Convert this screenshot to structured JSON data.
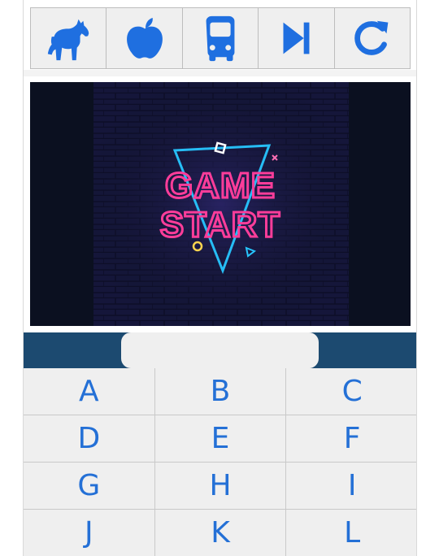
{
  "toolbar": {
    "buttons": [
      {
        "icon": "horse-icon",
        "action": "category"
      },
      {
        "icon": "apple-icon",
        "action": "category"
      },
      {
        "icon": "bus-icon",
        "action": "category"
      },
      {
        "icon": "skip-icon",
        "action": "skip"
      },
      {
        "icon": "redo-icon",
        "action": "restart"
      }
    ],
    "icon_color": "#1f6fe0"
  },
  "game_image": {
    "line1": "GAME",
    "line2": "START",
    "neon_pink": "#ff3d9a",
    "neon_blue": "#27c6ff"
  },
  "answer": {
    "value": ""
  },
  "keypad": {
    "keys": [
      "A",
      "B",
      "C",
      "D",
      "E",
      "F",
      "G",
      "H",
      "I",
      "J",
      "K",
      "L"
    ],
    "key_color": "#2470d6"
  }
}
